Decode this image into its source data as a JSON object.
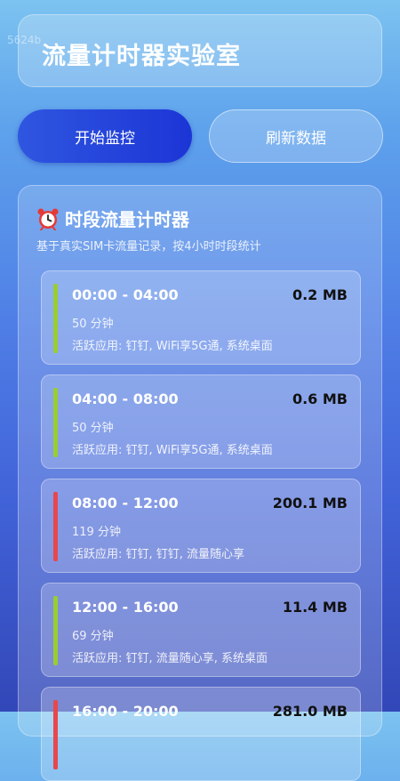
{
  "watermark": "5624b",
  "header": {
    "title": "流量计时器实验室"
  },
  "buttons": {
    "start_label": "开始监控",
    "refresh_label": "刷新数据"
  },
  "panel": {
    "icon": "alarm-clock-icon",
    "title": "时段流量计时器",
    "subtitle": "基于真实SIM卡流量记录，按4小时时段统计"
  },
  "slots": [
    {
      "time": "00:00 - 04:00",
      "usage": "0.2 MB",
      "duration": "50 分钟",
      "apps": "活跃应用: 钉钉, WiFi享5G通, 系统桌面",
      "status_color": "#9acd32"
    },
    {
      "time": "04:00 - 08:00",
      "usage": "0.6 MB",
      "duration": "50 分钟",
      "apps": "活跃应用: 钉钉, WiFi享5G通, 系统桌面",
      "status_color": "#9acd32"
    },
    {
      "time": "08:00 - 12:00",
      "usage": "200.1 MB",
      "duration": "119 分钟",
      "apps": "活跃应用: 钉钉, 钉钉, 流量随心享",
      "status_color": "#e8474c"
    },
    {
      "time": "12:00 - 16:00",
      "usage": "11.4 MB",
      "duration": "69 分钟",
      "apps": "活跃应用: 钉钉, 流量随心享, 系统桌面",
      "status_color": "#9acd32"
    },
    {
      "time": "16:00 - 20:00",
      "usage": "281.0 MB",
      "duration": "",
      "apps": "",
      "status_color": "#e8474c"
    }
  ]
}
